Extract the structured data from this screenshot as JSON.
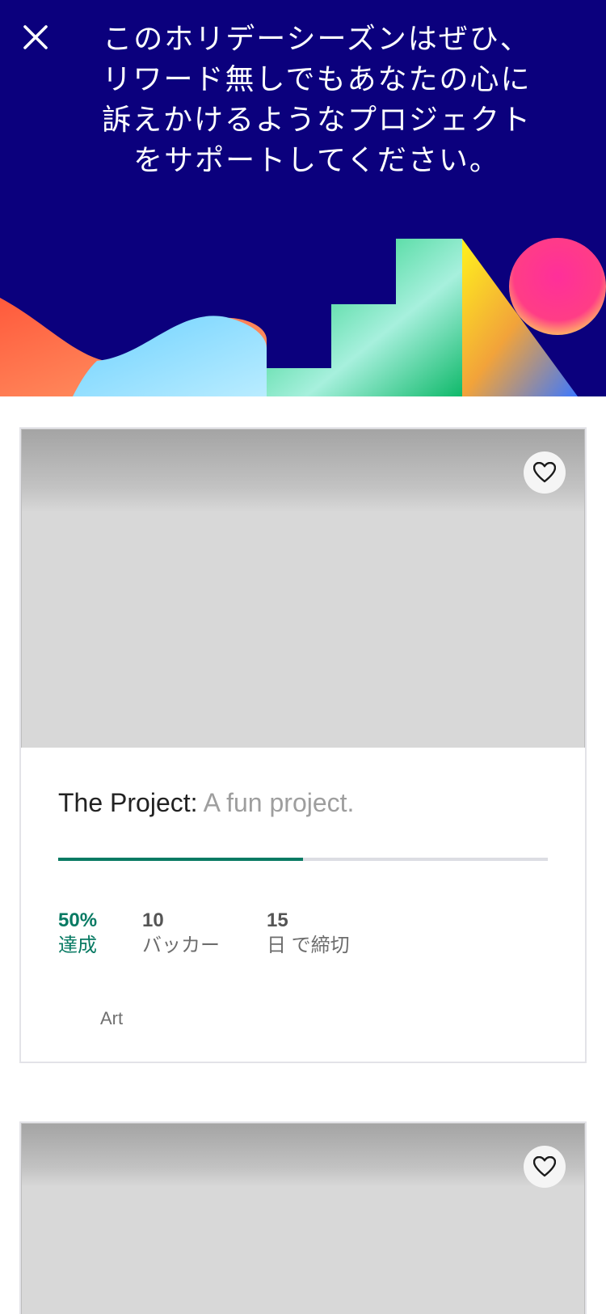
{
  "header": {
    "title_lines": [
      "このホリデーシーズンはぜひ、",
      "リワード無しでもあなたの心に",
      "訴えかけるようなプロジェクト",
      "をサポートしてください。"
    ],
    "background_color": "#0b007d"
  },
  "projects": [
    {
      "name": "The Project:",
      "blurb": "A fun project.",
      "funded_percent": 50,
      "stats": {
        "funded_value": "50%",
        "funded_label": "達成",
        "backers_value": "10",
        "backers_label": "バッカー",
        "days_value": "15",
        "days_label": "日 で締切"
      },
      "category": "Art"
    },
    {
      "name": "",
      "blurb": ""
    }
  ],
  "colors": {
    "accent_green": "#087a63",
    "progress_track": "#dcdde3",
    "image_placeholder": "#d8d8d8"
  },
  "icons": {
    "close": "close-icon",
    "save": "heart-icon"
  }
}
